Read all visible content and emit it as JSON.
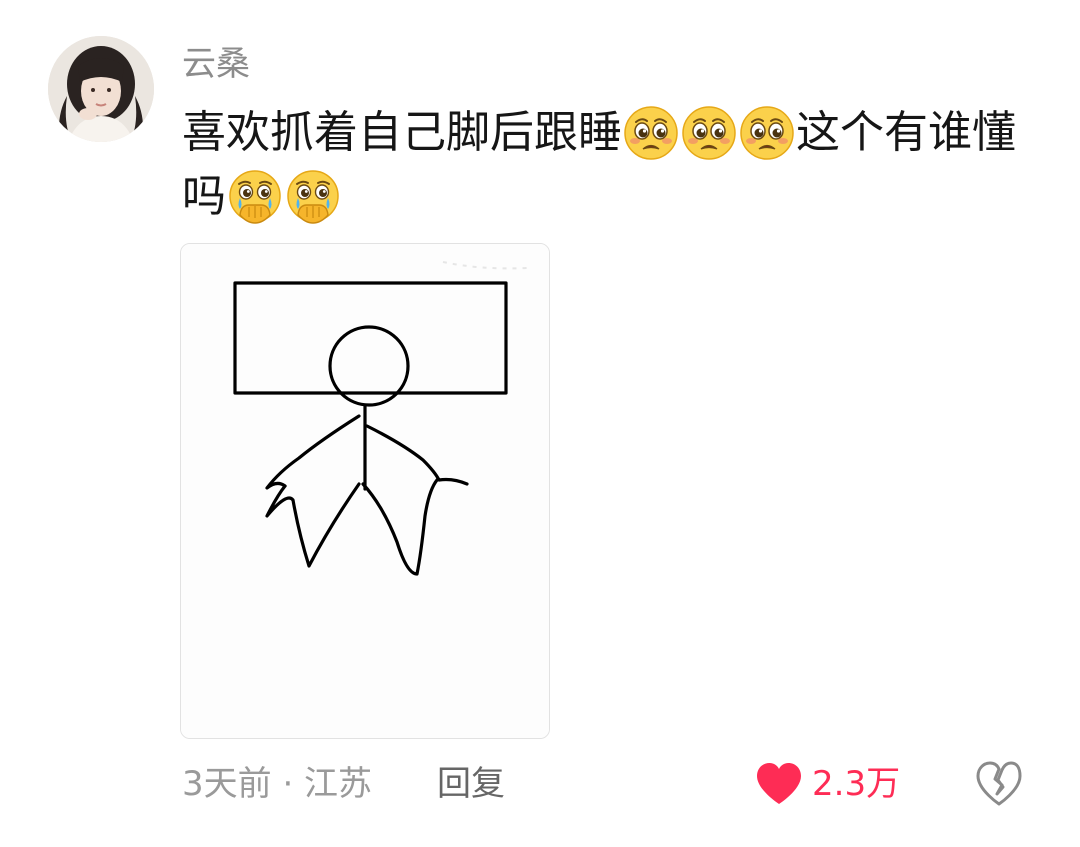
{
  "comment": {
    "username": "云桑",
    "text_parts": [
      {
        "type": "text",
        "value": "喜欢抓着自己脚后跟睡"
      },
      {
        "type": "emoji",
        "icon": "pleading-face-icon"
      },
      {
        "type": "emoji",
        "icon": "pleading-face-icon"
      },
      {
        "type": "emoji",
        "icon": "pleading-face-icon"
      },
      {
        "type": "text",
        "value": "这个有谁懂吗"
      },
      {
        "type": "emoji",
        "icon": "crying-hand-over-mouth-icon"
      },
      {
        "type": "emoji",
        "icon": "crying-hand-over-mouth-icon"
      }
    ],
    "meta": "3天前 · 江苏",
    "reply_label": "回复",
    "like_count": "2.3万"
  },
  "colors": {
    "like": "#fe2c55",
    "meta": "#9a9a9a",
    "username": "#8c8c8c"
  }
}
